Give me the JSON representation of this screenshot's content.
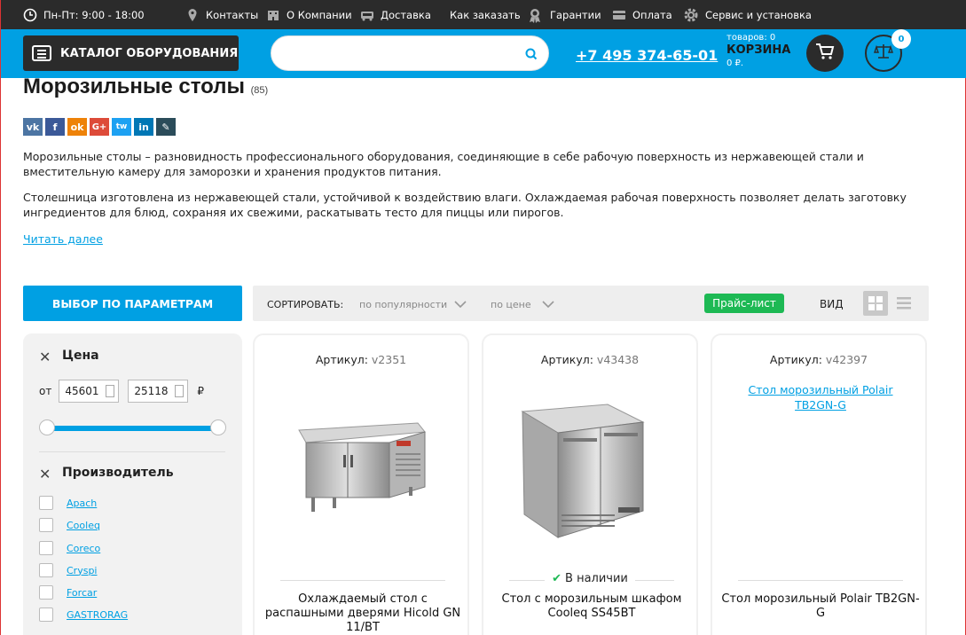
{
  "topbar": {
    "hours": "Пн-Пт: 9:00 - 18:00",
    "contacts": "Контакты",
    "about": "О Компании",
    "delivery": "Доставка",
    "how_to_order": "Как заказать",
    "guarantees": "Гарантии",
    "payment": "Оплата",
    "service": "Сервис и установка"
  },
  "header": {
    "catalog_label": "КАТАЛОГ ОБОРУДОВАНИЯ",
    "search_placeholder": "",
    "phone": "+7 495 374-65-01",
    "cart_items": "товаров: 0",
    "cart_label": "КОРЗИНА",
    "cart_sum": "0 ₽.",
    "compare_count": "0"
  },
  "page": {
    "title": "Морозильные столы",
    "count": "(85)",
    "desc1": "Морозильные столы – разновидность профессионального оборудования, соединяющие в себе рабочую поверхность из нержавеющей стали и вместительную камеру для заморозки и хранения продуктов питания.",
    "desc2": "Столешница изготовлена из нержавеющей стали, устойчивой к воздействию влаги. Охлаждаемая рабочая поверхность позволяет делать заготовку ингредиентов для блюд, сохраняя их свежими, раскатывать тесто для пиццы или пирогов.",
    "read_more": "Читать далее"
  },
  "social": [
    "vk",
    "f",
    "ok",
    "G+",
    "tw",
    "in",
    "✎"
  ],
  "filter": {
    "button": "ВЫБОР ПО ПАРАМЕТРАМ",
    "price_title": "Цена",
    "from_label": "от",
    "price_from": "45601",
    "price_to": "25118",
    "currency": "₽",
    "maker_title": "Производитель",
    "brands": [
      "Apach",
      "Cooleq",
      "Coreco",
      "Cryspi",
      "Forcar",
      "GASTRORAG"
    ]
  },
  "sort": {
    "label": "СОРТИРОВАТЬ:",
    "by_popularity": "по популярности",
    "by_price": "по цене",
    "price_list": "Прайс-лист",
    "view_label": "ВИД"
  },
  "products": [
    {
      "article_label": "Артикул:",
      "article": "v2351",
      "name": "Охлаждаемый стол с распашными дверями Hicold GN 11/BT",
      "stock": ""
    },
    {
      "article_label": "Артикул:",
      "article": "v43438",
      "name": "Стол с морозильным шкафом Cooleq SS45BT",
      "stock": "В наличии"
    },
    {
      "article_label": "Артикул:",
      "article": "v42397",
      "name": "Стол морозильный Polair TB2GN-G",
      "image_alt": "Стол морозильный Polair TB2GN-G",
      "stock": ""
    }
  ],
  "colors": {
    "accent": "#00a0e3",
    "dark": "#2b2b2b",
    "green": "#1db954"
  }
}
